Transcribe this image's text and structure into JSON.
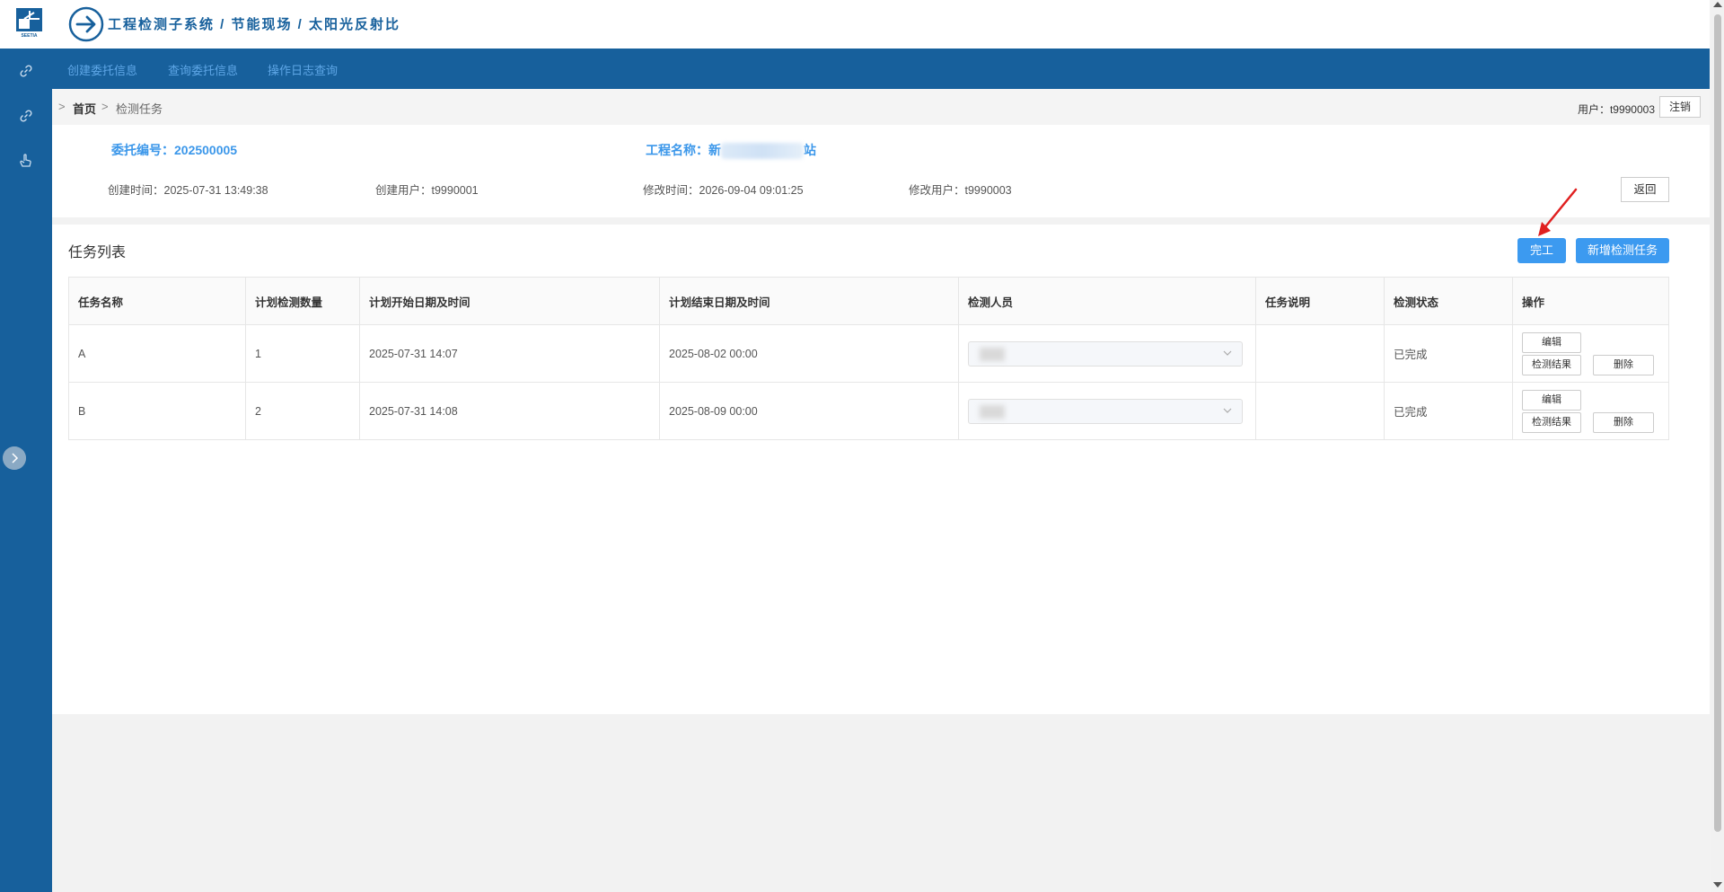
{
  "header": {
    "title": "工程检测子系统 / 节能现场 / 太阳光反射比",
    "logo_text": "SEETIA"
  },
  "sidebar": {
    "icons": [
      "link-icon",
      "link-icon",
      "hand-pointer-icon"
    ],
    "toggle_icon": "chevron-right-icon"
  },
  "topnav": {
    "items": [
      {
        "label": "创建委托信息"
      },
      {
        "label": "查询委托信息"
      },
      {
        "label": "操作日志查询"
      }
    ]
  },
  "breadcrumb": {
    "separator": ">",
    "home": "首页",
    "current": "检测任务"
  },
  "user": {
    "label": "用户：t9990003",
    "logout": "注销"
  },
  "commission": {
    "number_label": "委托编号：202500005",
    "project_label": "工程名称：",
    "project_name_start": "新",
    "project_name_end": "站",
    "created_time": "创建时间：2025-07-31 13:49:38",
    "created_user": "创建用户：t9990001",
    "modified_time": "修改时间：2026-09-04 09:01:25",
    "modified_user": "修改用户：t9990003",
    "back_button": "返回"
  },
  "task_list": {
    "title": "任务列表",
    "complete_button": "完工",
    "add_button": "新增检测任务",
    "columns": [
      "任务名称",
      "计划检测数量",
      "计划开始日期及时间",
      "计划结束日期及时间",
      "检测人员",
      "任务说明",
      "检测状态",
      "操作"
    ],
    "rows": [
      {
        "name": "A",
        "quantity": "1",
        "start": "2025-07-31 14:07",
        "end": "2025-08-02 00:00",
        "description": "",
        "status": "已完成"
      },
      {
        "name": "B",
        "quantity": "2",
        "start": "2025-07-31 14:08",
        "end": "2025-08-09 00:00",
        "description": "",
        "status": "已完成"
      }
    ],
    "actions": {
      "edit": "编辑",
      "results": "检测结果",
      "delete": "删除"
    }
  },
  "colors": {
    "brand_blue": "#17609c",
    "accent_blue": "#3c9af0",
    "link_blue": "#3b97ea",
    "annotation_red": "#e02020"
  }
}
